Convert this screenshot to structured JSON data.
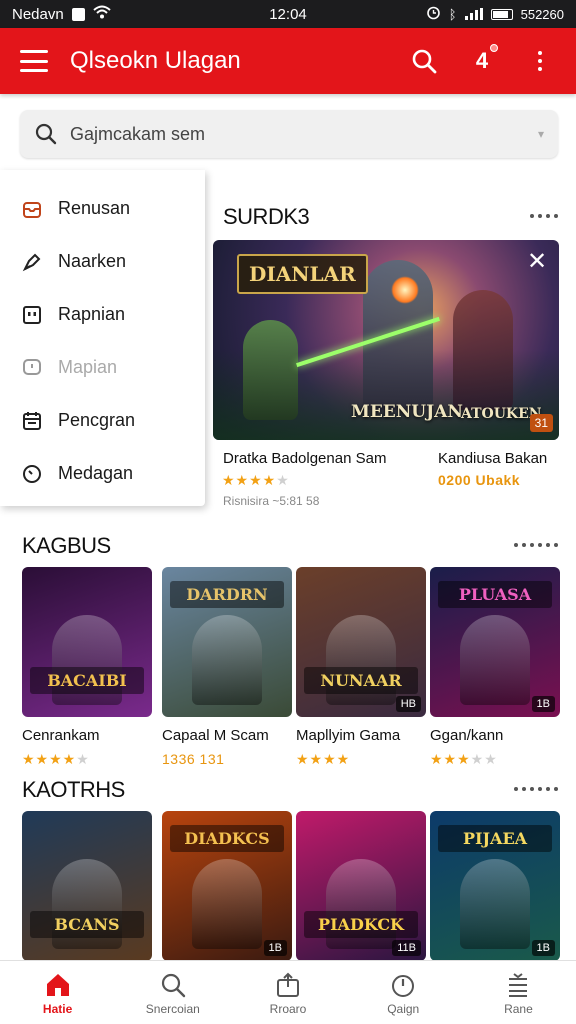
{
  "status_bar": {
    "carrier": "Nedavn",
    "time": "12:04",
    "network": "ᛒ",
    "battery_text": "552260"
  },
  "app_bar": {
    "title": "Qlseokn Ulagan",
    "notification_count": "4"
  },
  "search": {
    "placeholder": "Gajmcakam sem"
  },
  "drawer": {
    "items": [
      {
        "label": "Renusan",
        "icon": "inbox-icon"
      },
      {
        "label": "Naarken",
        "icon": "pen-icon"
      },
      {
        "label": "Rapnian",
        "icon": "window-icon"
      },
      {
        "label": "Mapian",
        "icon": "chat-icon",
        "disabled": true
      },
      {
        "label": "Pencgran",
        "icon": "calendar-icon"
      },
      {
        "label": "Medagan",
        "icon": "clock-icon"
      }
    ]
  },
  "featured_section": {
    "title": "SURDK3",
    "banner": {
      "logo": "DIANLAR",
      "bottom_left": "MEENUJAN",
      "bottom_right": "ATOUKEN",
      "tag": "31"
    },
    "items": [
      {
        "title": "Dratka Badolgenan Sam",
        "rating": 4,
        "meta": "Risnisira ~5:81 58"
      },
      {
        "title": "Kandiusa Bakan",
        "price": "0200 Ubakk"
      }
    ]
  },
  "section_two": {
    "title": "KAGBUS",
    "games": [
      {
        "title": "Cenrankam",
        "logo": "BACAIBI",
        "rating": 4,
        "price": "",
        "badge": "",
        "colors": [
          "#2a0e36",
          "#7a2a8c"
        ],
        "logo_color": "#f2c14e"
      },
      {
        "title": "Capaal M Scam",
        "logo": "DARDRN",
        "rating": 0,
        "price": "1336 131",
        "badge": "",
        "colors": [
          "#6a86a0",
          "#3a4a36"
        ],
        "logo_color": "#e6c36a"
      },
      {
        "title": "Mapllyim Gama",
        "logo": "NUNAAR",
        "rating": 4,
        "price": "",
        "badge": "HB",
        "colors": [
          "#6b3f2a",
          "#3a2a40"
        ],
        "logo_color": "#f0d060"
      },
      {
        "title": "Ggan/kann",
        "logo": "PLUASA",
        "rating": 3,
        "price": "",
        "badge": "1B",
        "colors": [
          "#1a1e4a",
          "#7a1050"
        ],
        "logo_color": "#f060c0"
      }
    ]
  },
  "section_three": {
    "title": "KAOTRHS",
    "games": [
      {
        "logo": "BCANS",
        "badge": "",
        "colors": [
          "#203a58",
          "#5a3a20"
        ],
        "logo_color": "#f2d060"
      },
      {
        "logo": "DIADKCS",
        "badge": "1B",
        "colors": [
          "#b8440e",
          "#3a1a10"
        ],
        "logo_color": "#f4c050"
      },
      {
        "logo": "PIADKCK",
        "badge": "11B",
        "colors": [
          "#c01a6a",
          "#2a1640"
        ],
        "logo_color": "#f9d04a"
      },
      {
        "logo": "PIJAEA",
        "badge": "1B",
        "colors": [
          "#0c3a6a",
          "#1a5a4a"
        ],
        "logo_color": "#f5d860"
      }
    ]
  },
  "bottom_nav": {
    "items": [
      {
        "label": "Hatie",
        "icon": "home-icon",
        "active": true
      },
      {
        "label": "Snercoian",
        "icon": "search-icon"
      },
      {
        "label": "Rroaro",
        "icon": "share-icon"
      },
      {
        "label": "Qaign",
        "icon": "timer-icon"
      },
      {
        "label": "Rane",
        "icon": "menu-lines-icon"
      }
    ]
  },
  "colors": {
    "brand": "#e3151a",
    "star": "#f2a115",
    "price": "#e8950f"
  }
}
